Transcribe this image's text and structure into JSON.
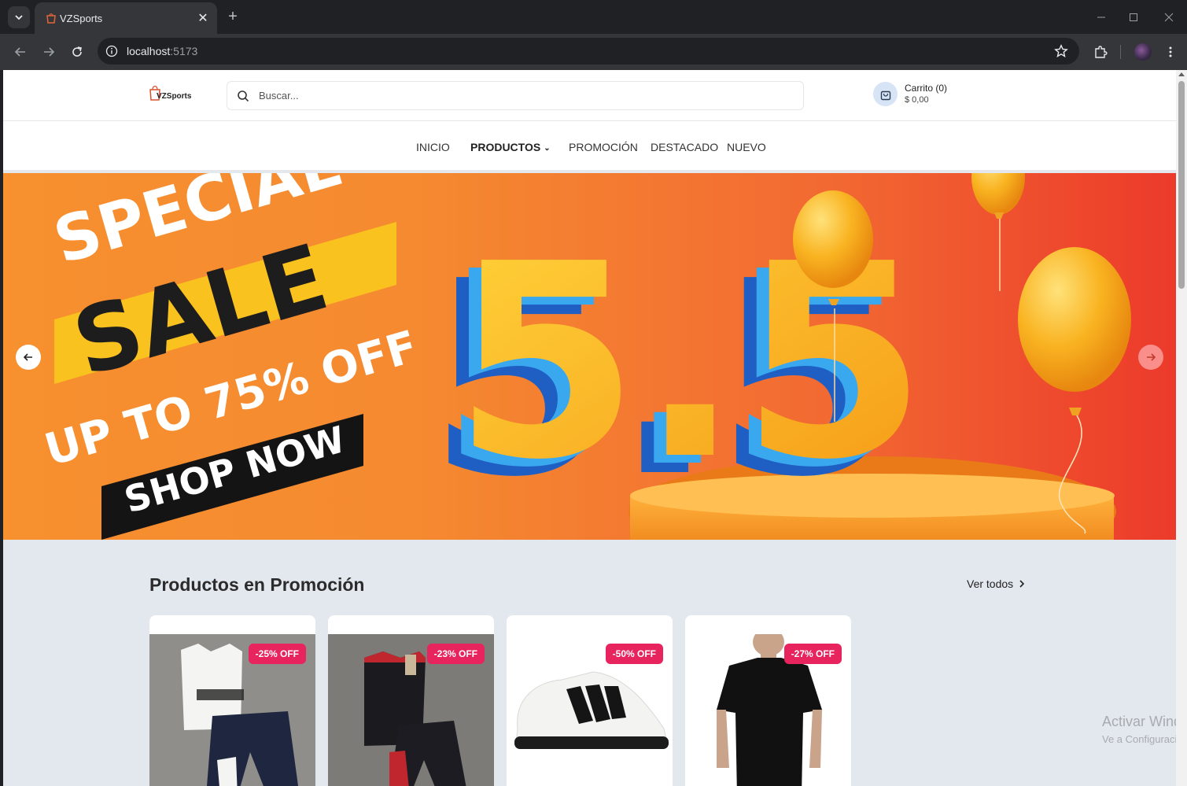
{
  "browser": {
    "tab_title": "VZSports",
    "url_host": "localhost",
    "url_port": ":5173"
  },
  "header": {
    "logo_text": "VZSports",
    "search_placeholder": "Buscar...",
    "cart_label": "Carrito (0)",
    "cart_total": "$ 0,00"
  },
  "nav": {
    "items": [
      {
        "label": "INICIO"
      },
      {
        "label": "PRODUCTOS"
      },
      {
        "label": "PROMOCIÓN"
      },
      {
        "label": "DESTACADO"
      },
      {
        "label": "NUEVO"
      }
    ]
  },
  "hero": {
    "line1": "SPECIAL",
    "line2": "SALE",
    "line3": "UP TO 75% OFF",
    "line4": "SHOP NOW",
    "big": "5.5"
  },
  "promo": {
    "title": "Productos en Promoción",
    "see_all": "Ver todos",
    "products": [
      {
        "badge": "-25% OFF"
      },
      {
        "badge": "-23% OFF"
      },
      {
        "badge": "-50% OFF"
      },
      {
        "badge": "-27% OFF"
      }
    ]
  },
  "watermark": {
    "line1": "Activar Windows",
    "line2": "Ve a Configuración para activar Windows."
  },
  "colors": {
    "badge": "#e8245e",
    "hero_left": "#f7902f",
    "hero_right": "#ec3a2b",
    "chrome_dark": "#202124",
    "chrome_mid": "#35363a"
  }
}
